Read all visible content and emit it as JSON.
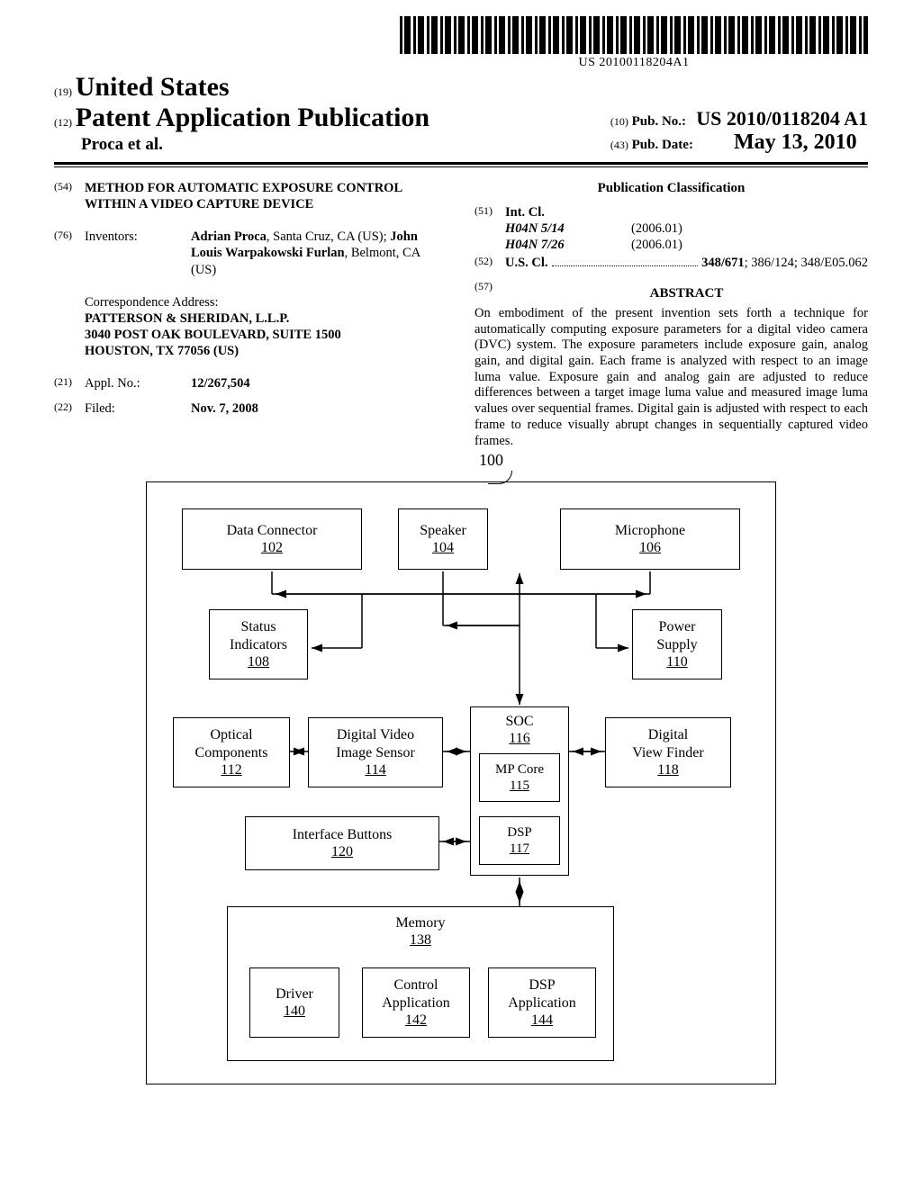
{
  "barcode_text": "US 20100118204A1",
  "header": {
    "country": "United States",
    "doc_type": "Patent Application Publication",
    "inventors_short": "Proca et al.",
    "pub_no_label": "Pub. No.:",
    "pub_no": "US 2010/0118204 A1",
    "pub_date_label": "Pub. Date:",
    "pub_date": "May 13, 2010",
    "code19": "(19)",
    "code12": "(12)",
    "code10": "(10)",
    "code43": "(43)"
  },
  "left": {
    "code54": "(54)",
    "title": "METHOD FOR AUTOMATIC EXPOSURE CONTROL WITHIN A VIDEO CAPTURE DEVICE",
    "code76": "(76)",
    "inventors_label": "Inventors:",
    "inventors_value_1": "Adrian Proca",
    "inventors_value_1_loc": ", Santa Cruz, CA (US); ",
    "inventors_value_2": "John Louis Warpakowski Furlan",
    "inventors_value_2_loc": ", Belmont, CA (US)",
    "corr_label": "Correspondence Address:",
    "corr_1": "PATTERSON & SHERIDAN, L.L.P.",
    "corr_2": "3040 POST OAK BOULEVARD, SUITE 1500",
    "corr_3": "HOUSTON, TX 77056 (US)",
    "code21": "(21)",
    "appl_label": "Appl. No.:",
    "appl_no": "12/267,504",
    "code22": "(22)",
    "filed_label": "Filed:",
    "filed_date": "Nov. 7, 2008"
  },
  "right": {
    "pub_class_label": "Publication Classification",
    "code51": "(51)",
    "intcl_label": "Int. Cl.",
    "intcl_1": "H04N 5/14",
    "intcl_1_year": "(2006.01)",
    "intcl_2": "H04N 7/26",
    "intcl_2_year": "(2006.01)",
    "code52": "(52)",
    "uscl_label": "U.S. Cl.",
    "uscl_value": "348/671; 386/124; 348/E05.062",
    "uscl_value_bold": "348/671",
    "uscl_value_rest": "; 386/124; 348/E05.062",
    "code57": "(57)",
    "abstract_label": "ABSTRACT",
    "abstract_text": "On embodiment of the present invention sets forth a technique for automatically computing exposure parameters for a digital video camera (DVC) system. The exposure parameters include exposure gain, analog gain, and digital gain. Each frame is analyzed with respect to an image luma value. Exposure gain and analog gain are adjusted to reduce differences between a target image luma value and measured image luma values over sequential frames. Digital gain is adjusted with respect to each frame to reduce visually abrupt changes in sequentially captured video frames."
  },
  "figure": {
    "ref_100": "100",
    "data_connector": "Data Connector",
    "data_connector_n": "102",
    "speaker": "Speaker",
    "speaker_n": "104",
    "microphone": "Microphone",
    "microphone_n": "106",
    "status": "Status Indicators",
    "status_n": "108",
    "power": "Power Supply",
    "power_n": "110",
    "optical": "Optical Components",
    "optical_n": "112",
    "sensor": "Digital Video Image Sensor",
    "sensor_n": "114",
    "soc": "SOC",
    "soc_n": "116",
    "mpcore": "MP Core",
    "mpcore_n": "115",
    "viewfinder": "Digital View Finder",
    "viewfinder_n": "118",
    "buttons": "Interface Buttons",
    "buttons_n": "120",
    "dsp": "DSP",
    "dsp_n": "117",
    "memory": "Memory",
    "memory_n": "138",
    "driver": "Driver",
    "driver_n": "140",
    "ctrlapp": "Control Application",
    "ctrlapp_n": "142",
    "dspapp": "DSP Application",
    "dspapp_n": "144"
  }
}
